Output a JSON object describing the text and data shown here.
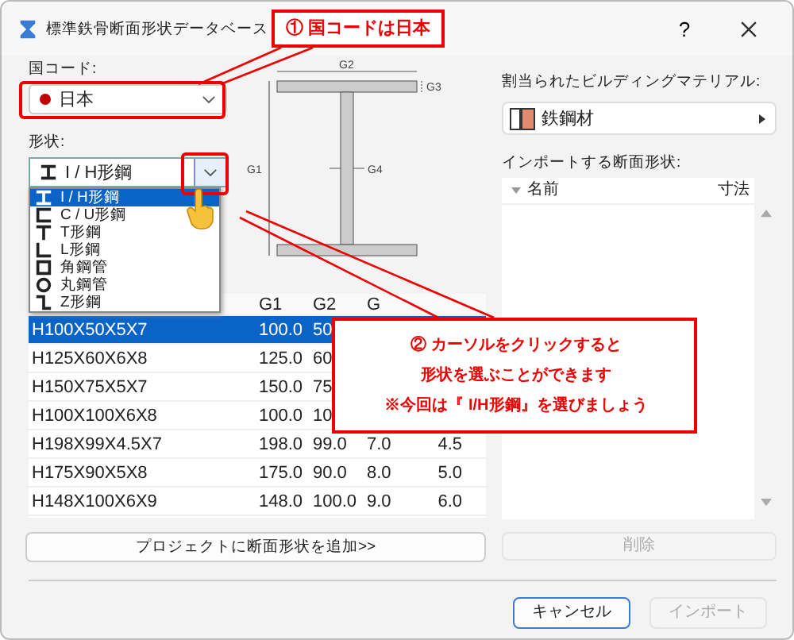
{
  "window": {
    "title": "標準鉄骨断面形状データベース",
    "help": "?"
  },
  "left": {
    "country_label": "国コード:",
    "country": "日本",
    "shape_label": "形状:",
    "shape": "I / H形鋼",
    "shape_options": [
      {
        "kind": "i",
        "label": "I / H形鋼",
        "selected": true
      },
      {
        "kind": "c",
        "label": "C / U形鋼",
        "selected": false
      },
      {
        "kind": "t",
        "label": "T形鋼",
        "selected": false
      },
      {
        "kind": "l",
        "label": "L形鋼",
        "selected": false
      },
      {
        "kind": "box",
        "label": "角鋼管",
        "selected": false
      },
      {
        "kind": "ring",
        "label": "丸鋼管",
        "selected": false
      },
      {
        "kind": "z",
        "label": "Z形鋼",
        "selected": false
      }
    ],
    "drawing_labels": {
      "g1": "G1",
      "g2": "G2",
      "g3": "G3",
      "g4": "G4"
    },
    "table": {
      "columns": [
        "G1",
        "G2",
        "G"
      ],
      "rows": [
        {
          "name": "H100X50X5X7",
          "cells": [
            "100.0",
            "50",
            "",
            ""
          ],
          "selected": true
        },
        {
          "name": "H125X60X6X8",
          "cells": [
            "125.0",
            "60",
            "",
            ""
          ],
          "selected": false
        },
        {
          "name": "H150X75X5X7",
          "cells": [
            "150.0",
            "75",
            "",
            ""
          ],
          "selected": false
        },
        {
          "name": "H100X100X6X8",
          "cells": [
            "100.0",
            "10",
            "",
            ""
          ],
          "selected": false
        },
        {
          "name": "H198X99X4.5X7",
          "cells": [
            "198.0",
            "99.0",
            "7.0",
            "4.5"
          ],
          "selected": false
        },
        {
          "name": "H175X90X5X8",
          "cells": [
            "175.0",
            "90.0",
            "8.0",
            "5.0"
          ],
          "selected": false
        },
        {
          "name": "H148X100X6X9",
          "cells": [
            "148.0",
            "100.0",
            "9.0",
            "6.0"
          ],
          "selected": false
        }
      ]
    },
    "add_button": "プロジェクトに断面形状を追加>>"
  },
  "right": {
    "material_label": "割当られたビルディングマテリアル:",
    "material": "鉄鋼材",
    "import_label": "インポートする断面形状:",
    "list_columns": [
      "名前",
      "寸法"
    ],
    "delete_button": {
      "label": "削除",
      "disabled": true
    }
  },
  "buttons": [
    {
      "label": "キャンセル",
      "disabled": false
    },
    {
      "label": "インポート",
      "disabled": true
    }
  ],
  "callouts": [
    [
      "① 国コードは日本"
    ],
    [
      "② カーソルをクリックすると",
      "形状を選ぶことができます",
      "※今回は『 I/H形鋼』を選びましょう"
    ]
  ]
}
